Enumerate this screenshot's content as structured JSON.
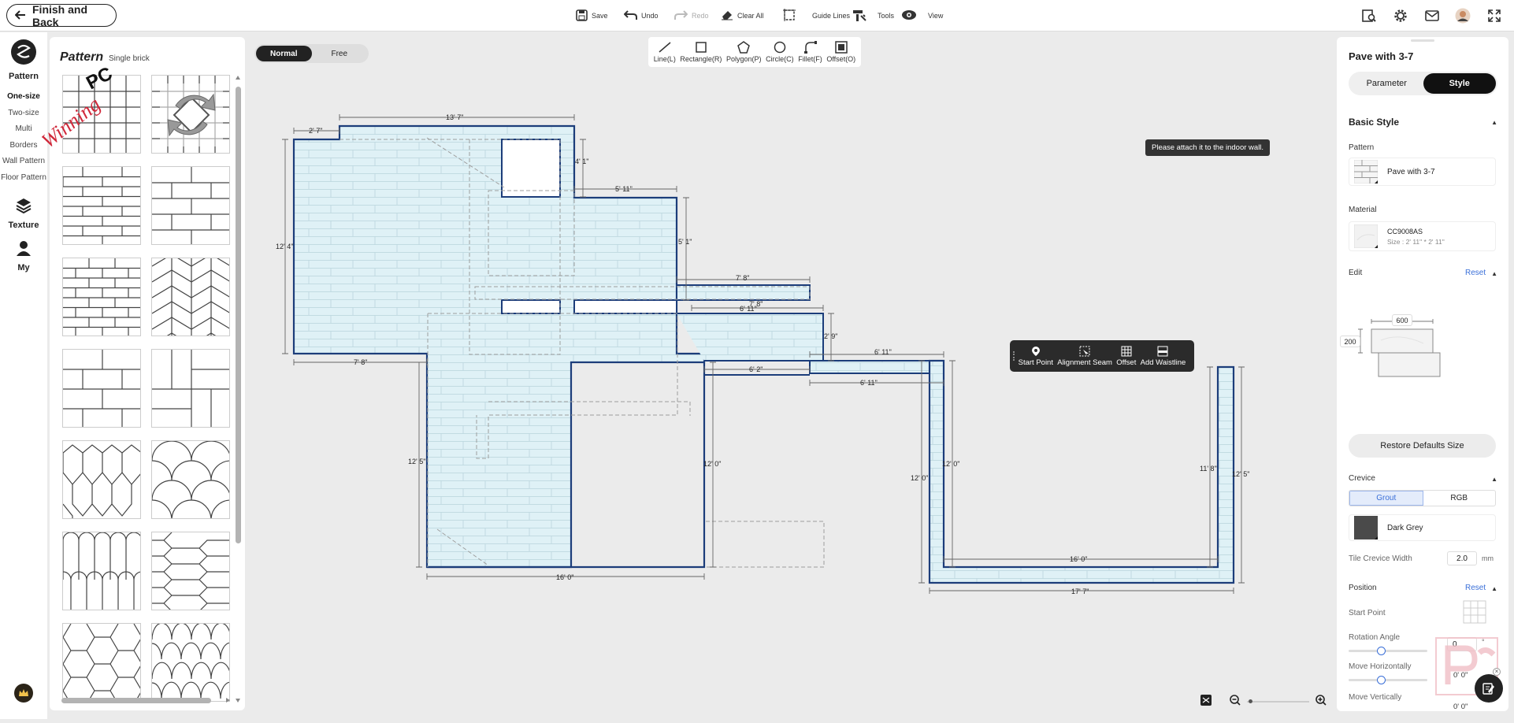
{
  "topbar": {
    "back_label": "Finish and Back",
    "save": "Save",
    "undo": "Undo",
    "redo": "Redo",
    "clear_all": "Clear All",
    "guide_lines": "Guide Lines",
    "tools": "Tools",
    "view": "View"
  },
  "leftnav": {
    "pattern": "Pattern",
    "subs": [
      "One-size",
      "Two-size",
      "Multi",
      "Borders",
      "Wall Pattern",
      "Floor Pattern"
    ],
    "texture": "Texture",
    "my": "My"
  },
  "panel": {
    "title": "Pattern",
    "subtitle": "Single brick",
    "watermark_pc": "PC",
    "watermark_text": "Winning"
  },
  "mode": {
    "normal": "Normal",
    "free": "Free"
  },
  "drawtools": [
    "Line(L)",
    "Rectangle(R)",
    "Polygon(P)",
    "Circle(C)",
    "Fillet(F)",
    "Offset(O)"
  ],
  "canvas": {
    "tooltip": "Please attach it to the indoor wall.",
    "context_menu": [
      "Start Point",
      "Alignment Seam",
      "Offset",
      "Add Waistline"
    ],
    "dims": {
      "top": "13' 7\"",
      "top_left": "2' 7\"",
      "left": "12' 4\"",
      "bottom_left": "7' 8\"",
      "notch_h": "4' 1\"",
      "right_top": "5' 11\"",
      "right_side": "5' 1\"",
      "ledge1": "7' 8\"",
      "ledge2": "7' 8\"",
      "ledge3": "6' 11\"",
      "step_h": "2' 9\"",
      "mid_bottom": "6' 2\"",
      "connector_top": "6' 11\"",
      "connector_bottom": "6' 11\"",
      "lower_left": "12' 5\"",
      "lower_right": "12' 0\"",
      "lower_bottom": "16' 0\"",
      "u_left_outer": "12' 0\"",
      "u_left_inner": "12' 0\"",
      "u_bottom_inner": "16' 0\"",
      "u_bottom_outer": "17' 7\"",
      "u_right_inner": "11' 8\"",
      "u_right_outer": "12' 5\""
    }
  },
  "rpanel": {
    "title": "Pave with 3-7",
    "tab_parameter": "Parameter",
    "tab_style": "Style",
    "basic_style": "Basic Style",
    "pattern_label": "Pattern",
    "pattern_value": "Pave with 3-7",
    "material_label": "Material",
    "material_code": "CC9008AS",
    "material_size": "Size : 2' 11\" * 2' 11\"",
    "edit_label": "Edit",
    "reset": "Reset",
    "edit_w": "600",
    "edit_h": "200",
    "restore": "Restore Defaults Size",
    "crevice": "Crevice",
    "grout": "Grout",
    "rgb": "RGB",
    "crevice_color": "Dark Grey",
    "width_label": "Tile Crevice Width",
    "width_value": "2.0",
    "width_unit": "mm",
    "position": "Position",
    "start_point": "Start Point",
    "rotation": "Rotation Angle",
    "rotation_value": "0",
    "rotation_unit": "°",
    "move_h": "Move Horizontally",
    "move_h_value": "0' 0\"",
    "move_v": "Move Vertically",
    "move_v_value": "0' 0\""
  },
  "colors": {
    "accent": "#3a6fd8",
    "floor_fill": "#dff1f6",
    "wall": "#1c3d7a",
    "watermark": "#d0283a"
  }
}
